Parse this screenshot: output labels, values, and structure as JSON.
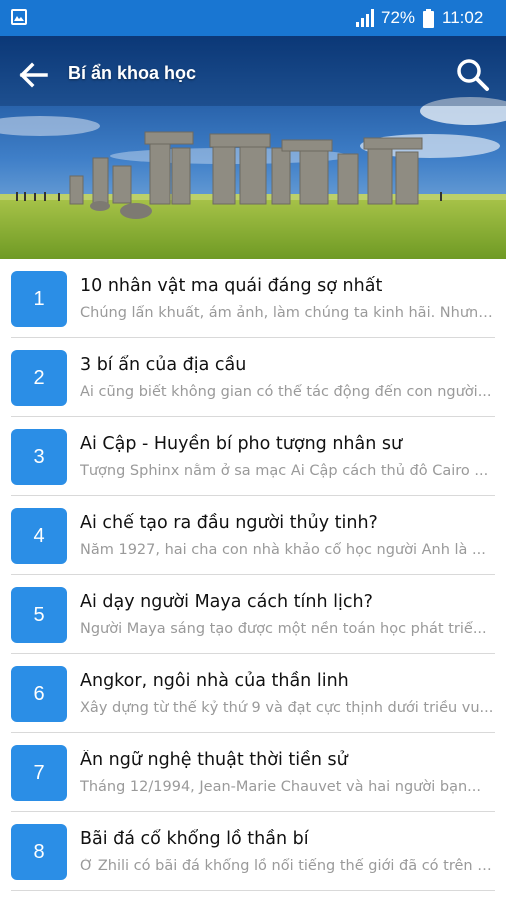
{
  "status_bar": {
    "battery": "72%",
    "time": "11:02",
    "icons": [
      "gallery-icon",
      "signal-icon",
      "battery-icon"
    ]
  },
  "toolbar": {
    "title": "Bí ẩn khoa học",
    "back_icon": "arrow-back-icon",
    "search_icon": "search-icon"
  },
  "colors": {
    "status_bar": "#1976d2",
    "badge": "#2b8ee6",
    "snippet_text": "#9a9a9a"
  },
  "articles": [
    {
      "number": "1",
      "title": "10 nhân vật ma quái đáng sợ nhất",
      "snippet": "Chúng lẩn khuất, ám ảnh, làm chúng ta kinh hãi. Nhưng..."
    },
    {
      "number": "2",
      "title": "3 bí ẩn của địa cầu",
      "snippet": "Ai cũng biết không gian có thể tác động đến con người..."
    },
    {
      "number": "3",
      "title": "Ai Cập - Huyền bí pho tượng nhân sư",
      "snippet": "Tượng Sphinx nằm ở sa mạc Ai Cập cách thủ đô Cairo ..."
    },
    {
      "number": "4",
      "title": "Ai chế tạo ra đầu người thủy tinh?",
      "snippet": "Năm 1927, hai cha con nhà khảo cổ học người Anh là ..."
    },
    {
      "number": "5",
      "title": "Ai dạy người Maya cách tính lịch?",
      "snippet": "Người Maya sáng tạo được một nền toán học phát triể..."
    },
    {
      "number": "6",
      "title": "Angkor, ngôi nhà của thần linh",
      "snippet": "Xây dựng từ thế kỷ thứ 9 và đạt cực thịnh dưới triều vu..."
    },
    {
      "number": "7",
      "title": "Ẩn ngữ nghệ thuật thời tiền sử",
      "snippet": "Tháng 12/1994, Jean-Marie Chauvet và hai người bạn..."
    },
    {
      "number": "8",
      "title": "Bãi đá cổ khổng lồ thần bí",
      "snippet": "Ở Zhili có bãi đá khổng lồ nổi tiếng thế giới đã có trên d..."
    }
  ]
}
